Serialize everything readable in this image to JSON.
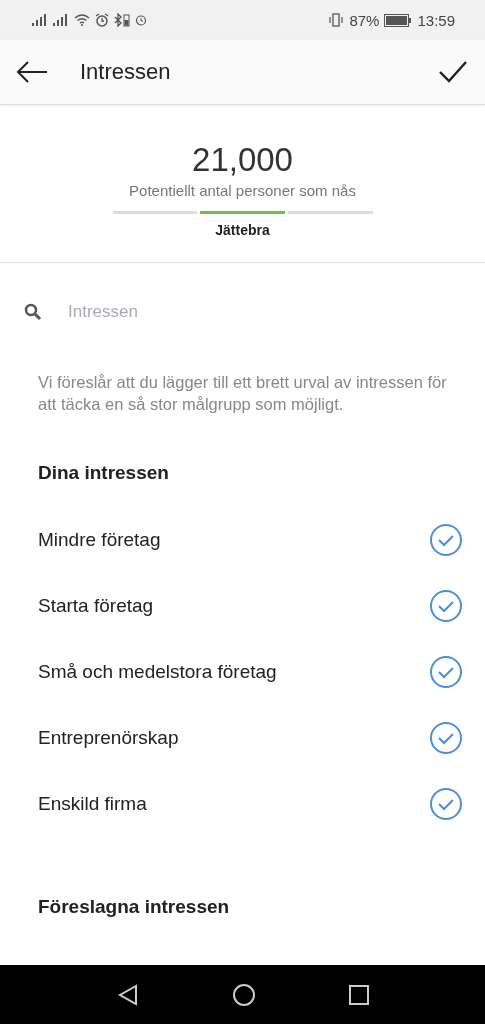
{
  "status_bar": {
    "battery_percent": "87%",
    "time": "13:59"
  },
  "header": {
    "title": "Intressen"
  },
  "reach": {
    "count": "21,000",
    "caption": "Potentiellt antal personer som nås",
    "segments": [
      {
        "selected": false
      },
      {
        "selected": true
      },
      {
        "selected": false
      }
    ],
    "rating": "Jättebra"
  },
  "search": {
    "placeholder": "Intressen"
  },
  "hint": "Vi föreslår att du lägger till ett brett urval av intressen för att täcka en så stor målgrupp som möjligt.",
  "your_interests": {
    "heading": "Dina intressen",
    "items": [
      {
        "label": "Mindre företag",
        "checked": true
      },
      {
        "label": "Starta företag",
        "checked": true
      },
      {
        "label": "Små och medelstora företag",
        "checked": true
      },
      {
        "label": "Entreprenörskap",
        "checked": true
      },
      {
        "label": "Enskild firma",
        "checked": true
      }
    ]
  },
  "suggested": {
    "heading": "Föreslagna intressen"
  }
}
